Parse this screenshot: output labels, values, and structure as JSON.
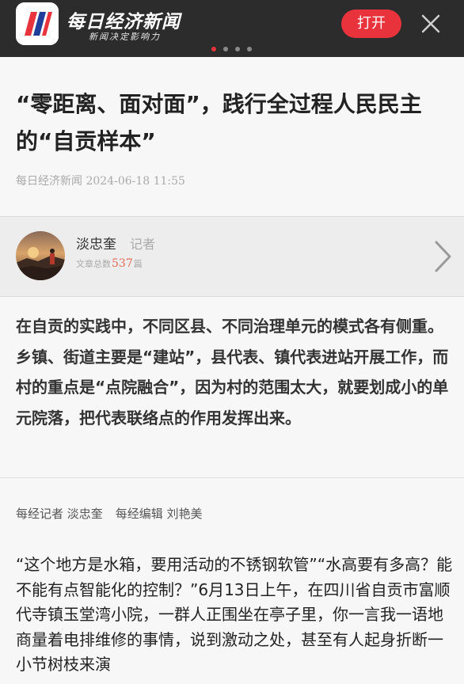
{
  "banner": {
    "brand_name": "每日经济新闻",
    "slogan": "新闻决定影响力",
    "open_label": "打开",
    "carousel_total": 4,
    "carousel_active": 1,
    "colors": {
      "accent": "#e8333d",
      "background": "#2c2c2c"
    }
  },
  "article": {
    "title": "“零距离、面对面”，践行全过程人民民主的“自贡样本”",
    "source": "每日经济新闻",
    "datetime": "2024-06-18 11:55",
    "author": {
      "name": "淡忠奎",
      "role": "记者",
      "count_label": "文章总数",
      "count": "537",
      "count_suffix": "篇"
    },
    "summary": "在自贡的实践中，不同区县、不同治理单元的模式各有侧重。乡镇、街道主要是“建站”，县代表、镇代表进站开展工作，而村的重点是“点院融合”，因为村的范围太大，就要划成小的单元院落，把代表联络点的作用发挥出来。",
    "byline": {
      "reporter": "每经记者 淡忠奎",
      "editor": "每经编辑 刘艳美"
    },
    "body": "“这个地方是水箱，要用活动的不锈钢软管”“水高要有多高？能不能有点智能化的控制？”6月13日上午，在四川省自贡市富顺代寺镇玉堂湾小院，一群人正围坐在亭子里，你一言我一语地商量着电排维修的事情，说到激动之处，甚至有人起身折断一小节树枝来演"
  }
}
